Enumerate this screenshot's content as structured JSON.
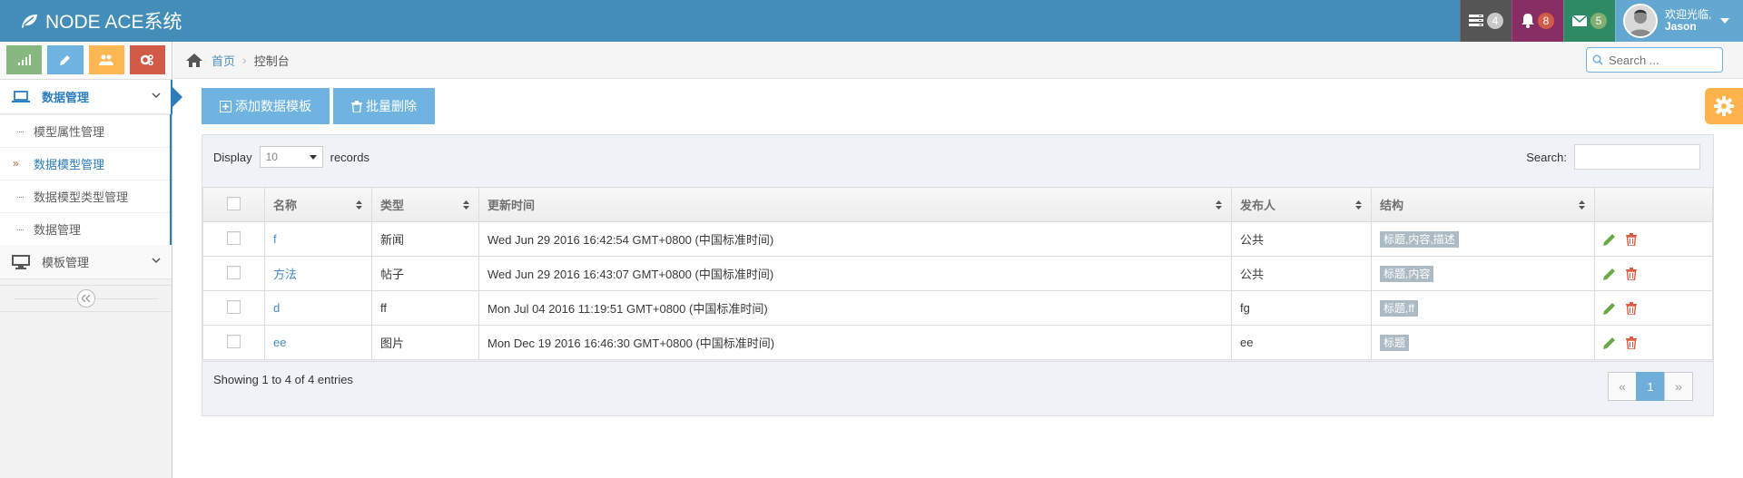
{
  "navbar": {
    "brand": "NODE ACE系统",
    "tasks_count": "4",
    "notifications_count": "8",
    "messages_count": "5",
    "welcome": "欢迎光临,",
    "username": "Jason"
  },
  "breadcrumb": {
    "home": "首页",
    "current": "控制台"
  },
  "search": {
    "placeholder": "Search ..."
  },
  "sidebar": {
    "menu": [
      {
        "label": "数据管理",
        "icon": "laptop-icon",
        "active": true,
        "children": [
          "模型属性管理",
          "数据模型管理",
          "数据模型类型管理",
          "数据管理"
        ],
        "active_child": "数据模型管理"
      },
      {
        "label": "模板管理",
        "icon": "desktop-icon",
        "active": false
      }
    ]
  },
  "toolbar": {
    "add_label": "添加数据模板",
    "batch_delete_label": "批量删除"
  },
  "table_controls": {
    "display_label": "Display",
    "page_size": "10",
    "records_label": "records",
    "search_label": "Search:"
  },
  "table": {
    "columns": [
      "名称",
      "类型",
      "更新时间",
      "发布人",
      "结构"
    ],
    "rows": [
      {
        "name": "f",
        "type": "新闻",
        "updated": "Wed Jun 29 2016 16:42:54 GMT+0800 (中国标准时间)",
        "publisher": "公共",
        "structure": "标题,内容,描述"
      },
      {
        "name": "方法",
        "type": "帖子",
        "updated": "Wed Jun 29 2016 16:43:07 GMT+0800 (中国标准时间)",
        "publisher": "公共",
        "structure": "标题,内容"
      },
      {
        "name": "d",
        "type": "ff",
        "updated": "Mon Jul 04 2016 11:19:51 GMT+0800 (中国标准时间)",
        "publisher": "fg",
        "structure": "标题,ff"
      },
      {
        "name": "ee",
        "type": "图片",
        "updated": "Mon Dec 19 2016 16:46:30 GMT+0800 (中国标准时间)",
        "publisher": "ee",
        "structure": "标题"
      }
    ]
  },
  "footer": {
    "info": "Showing 1 to 4 of 4 entries",
    "prev": "«",
    "page": "1",
    "next": "»"
  }
}
